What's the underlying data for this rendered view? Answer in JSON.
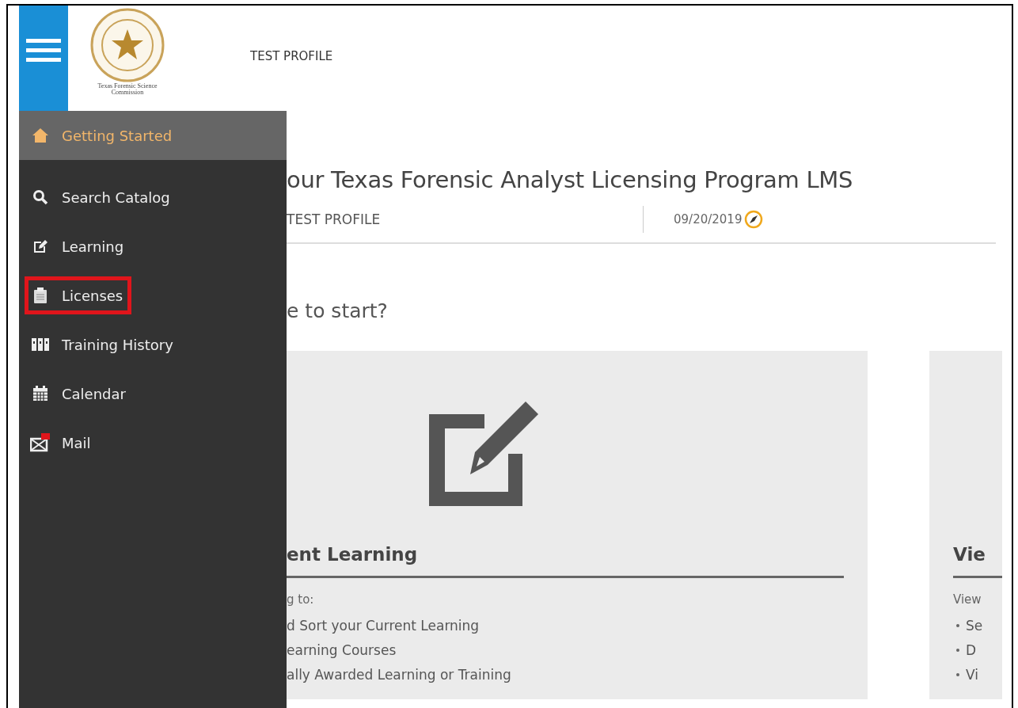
{
  "header": {
    "logo_text": "Texas Forensic Science Commission",
    "profile": "TEST PROFILE"
  },
  "sidebar": {
    "items": [
      {
        "label": "Getting Started",
        "selected": true,
        "highlighted": false
      },
      {
        "label": "Search Catalog",
        "selected": false,
        "highlighted": false
      },
      {
        "label": "Learning",
        "selected": false,
        "highlighted": false
      },
      {
        "label": "Licenses",
        "selected": false,
        "highlighted": true
      },
      {
        "label": "Training History",
        "selected": false,
        "highlighted": false
      },
      {
        "label": "Calendar",
        "selected": false,
        "highlighted": false
      },
      {
        "label": "Mail",
        "selected": false,
        "highlighted": false
      }
    ]
  },
  "main": {
    "title": "our Texas Forensic Analyst Licensing Program LMS",
    "user": "TEST PROFILE",
    "date": "09/20/2019",
    "question": "e to start?",
    "cards": [
      {
        "heading": "ent Learning",
        "intro": "g to:",
        "bullets": [
          "d Sort your Current Learning",
          "earning Courses",
          "ally Awarded Learning or Training"
        ]
      },
      {
        "heading": "Vie",
        "intro": "View",
        "bullets": [
          "Se",
          "D",
          "Vi"
        ]
      }
    ]
  }
}
